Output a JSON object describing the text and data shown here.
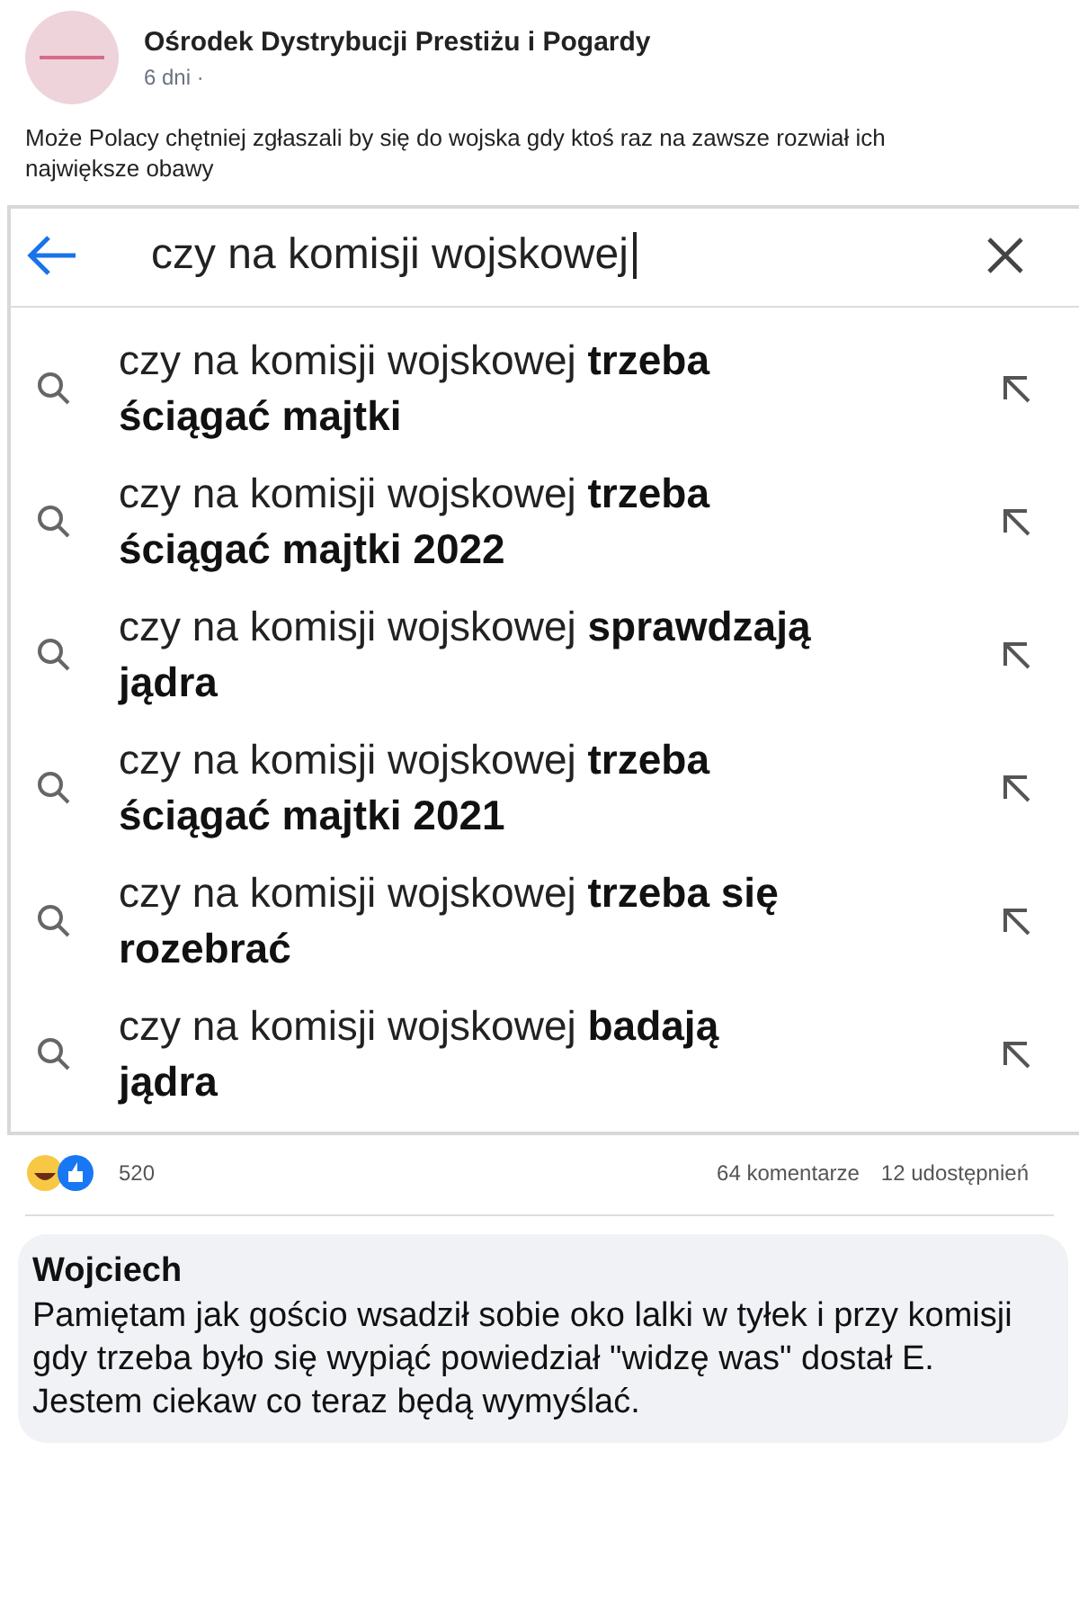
{
  "post": {
    "author": "Ośrodek Dystrybucji Prestiżu i Pogardy",
    "time": "6 dni ·",
    "text": "Może Polacy chętniej zgłaszali by się do wojska gdy ktoś raz na zawsze rozwiał ich największe obawy"
  },
  "search": {
    "value": "czy na komisji wojskowej"
  },
  "suggestions": [
    {
      "text": "czy na komisji wojskowej **trzeba ściągać majtki**"
    },
    {
      "text": "czy na komisji wojskowej **trzeba ściągać majtki 2022**"
    },
    {
      "text": "czy na komisji wojskowej **sprawdzają jądra**"
    },
    {
      "text": "czy na komisji wojskowej **trzeba ściągać majtki 2021**"
    },
    {
      "text": "czy na komisji wojskowej **trzeba się rozebrać**"
    },
    {
      "text": "czy na komisji wojskowej **badają jądra**"
    }
  ],
  "reactions": {
    "count": "520",
    "comments": "64 komentarze",
    "shares": "12 udostępnień"
  },
  "comment": {
    "author": "Wojciech",
    "text": "Pamiętam jak gościo wsadził sobie oko lalki w tyłek i przy komisji gdy trzeba było się wypiąć powiedział \"widzę was\" dostał E. Jestem ciekaw co teraz będą wymyślać."
  }
}
